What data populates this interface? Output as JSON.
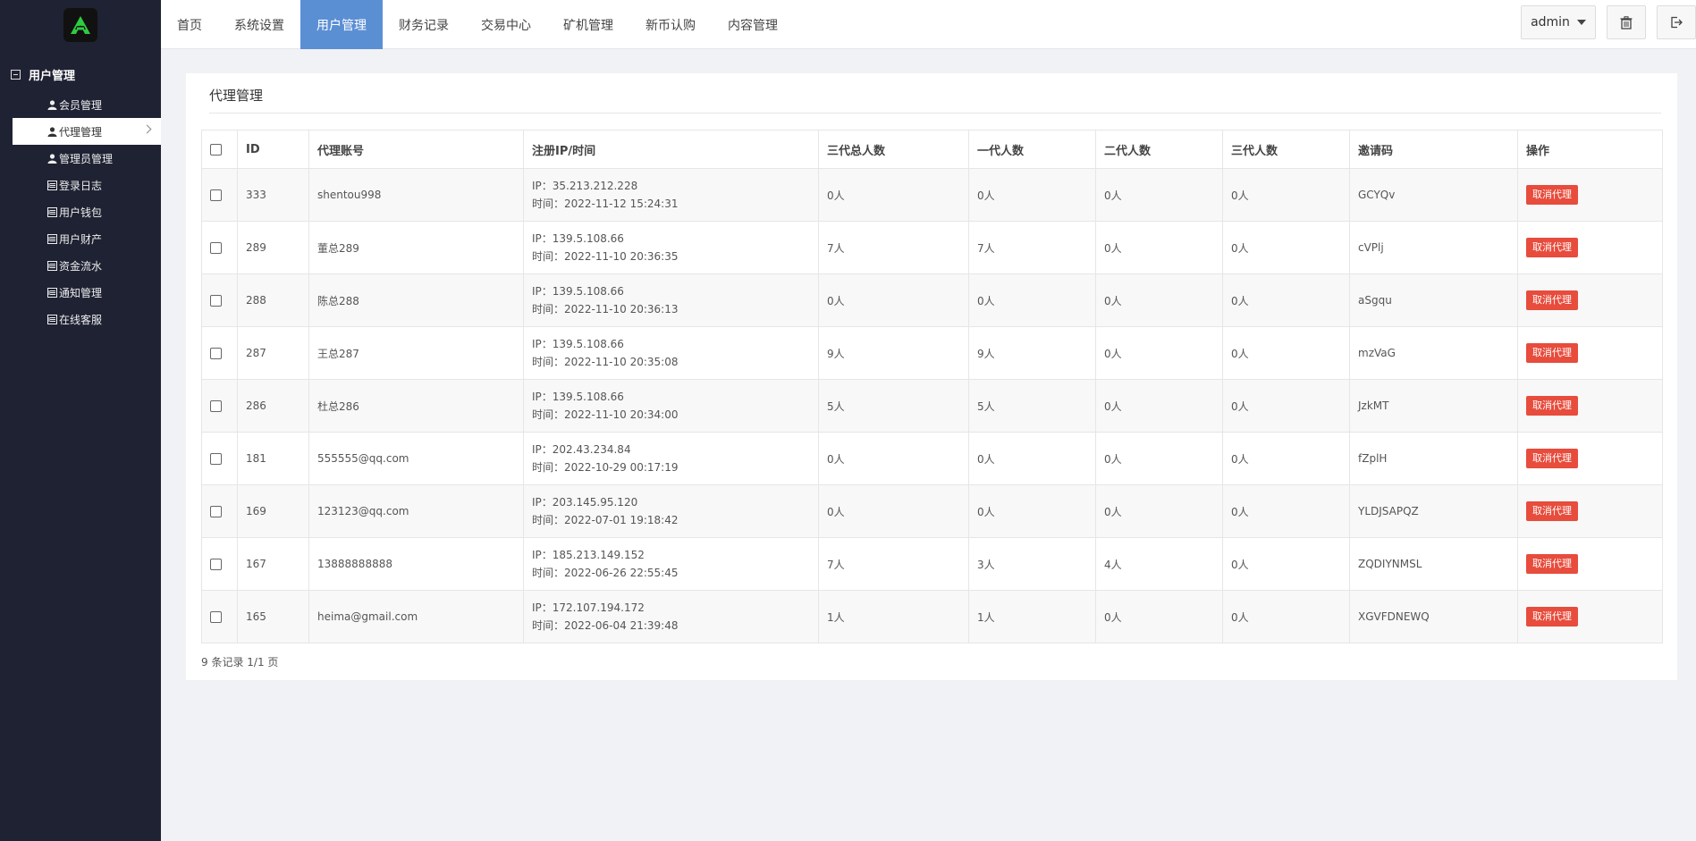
{
  "sidebar": {
    "group_title": "用户管理",
    "items": [
      {
        "label": "会员管理",
        "icon": "user-icon"
      },
      {
        "label": "代理管理",
        "icon": "user-icon"
      },
      {
        "label": "管理员管理",
        "icon": "user-icon"
      },
      {
        "label": "登录日志",
        "icon": "list-icon"
      },
      {
        "label": "用户钱包",
        "icon": "list-icon"
      },
      {
        "label": "用户财产",
        "icon": "list-icon"
      },
      {
        "label": "资金流水",
        "icon": "list-icon"
      },
      {
        "label": "通知管理",
        "icon": "list-icon"
      },
      {
        "label": "在线客服",
        "icon": "list-icon"
      }
    ],
    "active_index": 1
  },
  "nav": {
    "items": [
      "首页",
      "系统设置",
      "用户管理",
      "财务记录",
      "交易中心",
      "矿机管理",
      "新币认购",
      "内容管理"
    ],
    "active_index": 2
  },
  "header": {
    "admin_label": "admin"
  },
  "panel": {
    "title": "代理管理"
  },
  "table": {
    "headers": [
      "ID",
      "代理账号",
      "注册IP/时间",
      "三代总人数",
      "一代人数",
      "二代人数",
      "三代人数",
      "邀请码",
      "操作"
    ],
    "action_label": "取消代理",
    "ip_prefix": "IP：",
    "time_prefix": "时间：",
    "rows": [
      {
        "id": "333",
        "account": "shentou998",
        "ip": "35.213.212.228",
        "time": "2022-11-12 15:24:31",
        "total": "0人",
        "gen1": "0人",
        "gen2": "0人",
        "gen3": "0人",
        "code": "GCYQv"
      },
      {
        "id": "289",
        "account": "董总289",
        "ip": "139.5.108.66",
        "time": "2022-11-10 20:36:35",
        "total": "7人",
        "gen1": "7人",
        "gen2": "0人",
        "gen3": "0人",
        "code": "cVPlj"
      },
      {
        "id": "288",
        "account": "陈总288",
        "ip": "139.5.108.66",
        "time": "2022-11-10 20:36:13",
        "total": "0人",
        "gen1": "0人",
        "gen2": "0人",
        "gen3": "0人",
        "code": "aSgqu"
      },
      {
        "id": "287",
        "account": "王总287",
        "ip": "139.5.108.66",
        "time": "2022-11-10 20:35:08",
        "total": "9人",
        "gen1": "9人",
        "gen2": "0人",
        "gen3": "0人",
        "code": "mzVaG"
      },
      {
        "id": "286",
        "account": "杜总286",
        "ip": "139.5.108.66",
        "time": "2022-11-10 20:34:00",
        "total": "5人",
        "gen1": "5人",
        "gen2": "0人",
        "gen3": "0人",
        "code": "JzkMT"
      },
      {
        "id": "181",
        "account": "555555@qq.com",
        "ip": "202.43.234.84",
        "time": "2022-10-29 00:17:19",
        "total": "0人",
        "gen1": "0人",
        "gen2": "0人",
        "gen3": "0人",
        "code": "fZplH"
      },
      {
        "id": "169",
        "account": "123123@qq.com",
        "ip": "203.145.95.120",
        "time": "2022-07-01 19:18:42",
        "total": "0人",
        "gen1": "0人",
        "gen2": "0人",
        "gen3": "0人",
        "code": "YLDJSAPQZ"
      },
      {
        "id": "167",
        "account": "13888888888",
        "ip": "185.213.149.152",
        "time": "2022-06-26 22:55:45",
        "total": "7人",
        "gen1": "3人",
        "gen2": "4人",
        "gen3": "0人",
        "code": "ZQDIYNMSL"
      },
      {
        "id": "165",
        "account": "heima@gmail.com",
        "ip": "172.107.194.172",
        "time": "2022-06-04 21:39:48",
        "total": "1人",
        "gen1": "1人",
        "gen2": "0人",
        "gen3": "0人",
        "code": "XGVFDNEWQ"
      }
    ]
  },
  "footer": {
    "summary": "9 条记录 1/1 页"
  },
  "colors": {
    "sidebar_bg": "#1f2233",
    "nav_active": "#5b8fd4",
    "danger": "#e74c3c",
    "logo_green": "#2ecc40"
  }
}
